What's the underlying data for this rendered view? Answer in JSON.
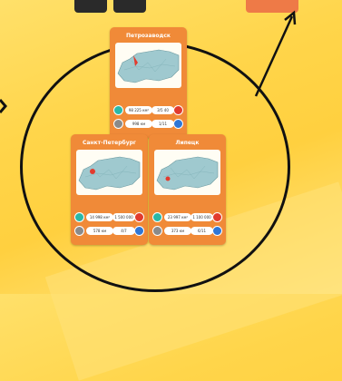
{
  "cards": [
    {
      "city": "Петрозаводск",
      "stats": [
        "98 225 км²",
        "3/5 40",
        "998 км",
        "1/11"
      ]
    },
    {
      "city": "Санкт-Петербург",
      "stats": [
        "14 998 км²",
        "1 500 000",
        "578 км",
        "4/7"
      ]
    },
    {
      "city": "Липецк",
      "stats": [
        "23 997 км²",
        "1 100 000",
        "373 км",
        "6/11"
      ]
    }
  ],
  "icons": [
    "area-icon",
    "population-icon",
    "distance-icon",
    "info-icon"
  ],
  "colors": {
    "card": "#f08a38",
    "map_land": "#9fc9cf",
    "accent": "#e23b2e"
  }
}
